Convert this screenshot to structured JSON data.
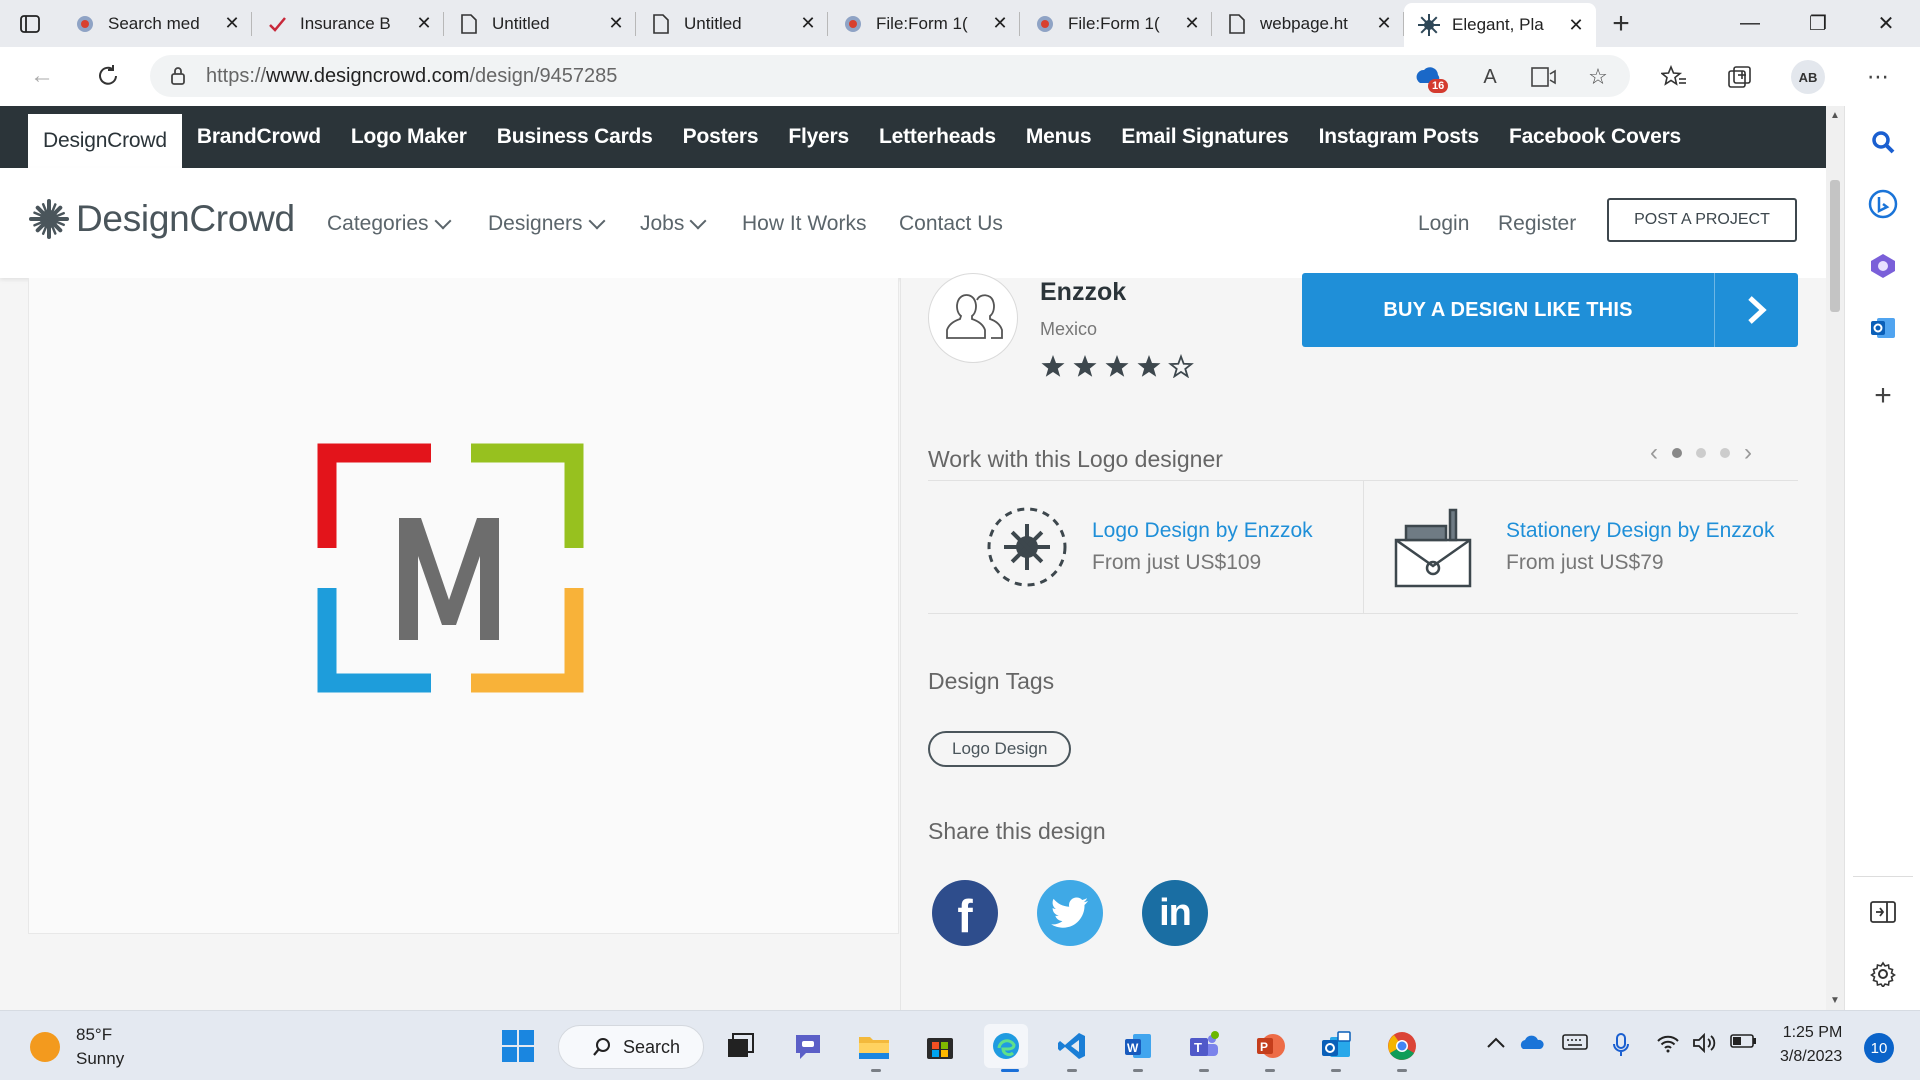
{
  "browser": {
    "tabs": [
      {
        "title": "Search med",
        "icon": "wiki-globe-icon"
      },
      {
        "title": "Insurance B",
        "icon": "checkmark-icon"
      },
      {
        "title": "Untitled",
        "icon": "document-icon"
      },
      {
        "title": "Untitled",
        "icon": "document-icon"
      },
      {
        "title": "File:Form 1(",
        "icon": "wiki-globe-icon"
      },
      {
        "title": "File:Form 1(",
        "icon": "wiki-globe-icon"
      },
      {
        "title": "webpage.ht",
        "icon": "document-icon"
      },
      {
        "title": "Elegant, Pla",
        "icon": "designcrowd-icon",
        "active": true
      }
    ],
    "url_prefix": "https://",
    "url_host": "www.designcrowd.com",
    "url_path": "/design/9457285",
    "extension_badge": "16",
    "profile_initials": "AB"
  },
  "dc_topnav": {
    "items": [
      "DesignCrowd",
      "BrandCrowd",
      "Logo Maker",
      "Business Cards",
      "Posters",
      "Flyers",
      "Letterheads",
      "Menus",
      "Email Signatures",
      "Instagram Posts",
      "Facebook Covers"
    ]
  },
  "dc_header": {
    "logo_text": "DesignCrowd",
    "nav": {
      "categories": "Categories",
      "designers": "Designers",
      "jobs": "Jobs",
      "how": "How It Works",
      "contact": "Contact Us"
    },
    "login": "Login",
    "register": "Register",
    "post_project": "POST A PROJECT"
  },
  "design": {
    "logo_letter": "M",
    "colors": {
      "red": "#e3141b",
      "green": "#97c11f",
      "blue": "#1e9ddb",
      "orange": "#f8b239",
      "letter": "#6d6d6d"
    }
  },
  "designer": {
    "name": "Enzzok",
    "location": "Mexico",
    "rating": 4,
    "rating_max": 5
  },
  "buy_button": "BUY A DESIGN LIKE THIS",
  "work_with": {
    "title": "Work with this Logo designer",
    "services": [
      {
        "link": "Logo Design by Enzzok",
        "price": "From just US$109"
      },
      {
        "link": "Stationery Design by Enzzok",
        "price": "From just US$79"
      }
    ]
  },
  "tags": {
    "title": "Design Tags",
    "items": [
      "Logo Design"
    ]
  },
  "share": {
    "title": "Share this design",
    "networks": [
      {
        "name": "facebook",
        "glyph": "f",
        "color": "#2e4d8c"
      },
      {
        "name": "twitter",
        "glyph": "t",
        "color": "#3fa9e6"
      },
      {
        "name": "linkedin",
        "glyph": "in",
        "color": "#1a6ea3"
      }
    ]
  },
  "taskbar": {
    "temp": "85°F",
    "condition": "Sunny",
    "search": "Search",
    "time": "1:25 PM",
    "date": "3/8/2023",
    "notifications": "10"
  }
}
